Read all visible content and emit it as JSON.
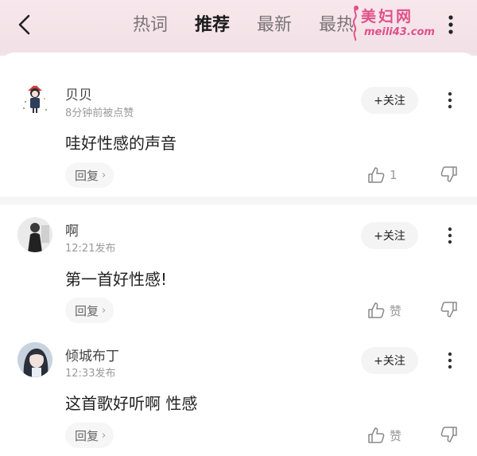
{
  "header": {
    "tabs": [
      {
        "label": "热词",
        "active": false
      },
      {
        "label": "推荐",
        "active": true
      },
      {
        "label": "最新",
        "active": false
      },
      {
        "label": "最热",
        "active": false
      }
    ]
  },
  "watermark": {
    "title": "美妇网",
    "url": "meili43.com"
  },
  "comments": [
    {
      "username": "贝贝",
      "meta": "8分钟前被点赞",
      "content": "哇好性感的声音",
      "follow_label": "+关注",
      "reply_label": "回复",
      "like_label": "1"
    },
    {
      "username": "啊",
      "meta": "12:21发布",
      "content": "第一首好性感!",
      "follow_label": "+关注",
      "reply_label": "回复",
      "like_label": "赞"
    },
    {
      "username": "倾城布丁",
      "meta": "12:33发布",
      "content": "这首歌好听啊 性感",
      "follow_label": "+关注",
      "reply_label": "回复",
      "like_label": "赞"
    }
  ],
  "icons": {
    "back": "chevron-left-icon",
    "more": "more-vertical-icon",
    "like": "thumbs-up-icon",
    "dislike": "thumbs-down-icon",
    "reply_chevron": "chevron-right-icon"
  },
  "colors": {
    "header_bg": "#f4e4e9",
    "watermark": "#e0508a",
    "active_tab": "#1a1a1a",
    "inactive_tab": "#7a7478"
  }
}
